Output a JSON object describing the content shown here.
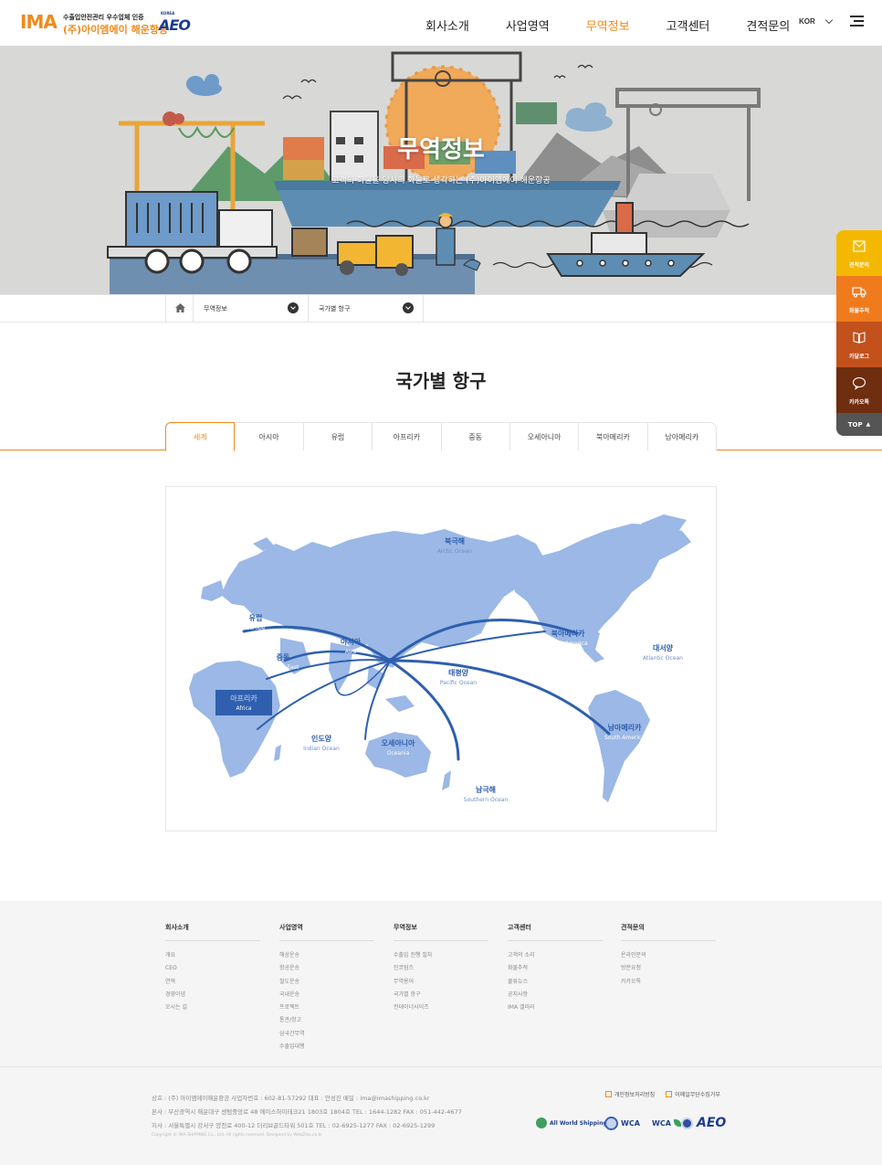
{
  "header": {
    "logo": {
      "brand": "IMA",
      "tagline": "수출입안전관리 우수업체 인증",
      "company": "(주)아이엠에이 해운항공",
      "korea": "KOREA",
      "aeo": "AEO"
    },
    "nav": [
      "회사소개",
      "사업영역",
      "무역정보",
      "고객센터",
      "견적문의"
    ],
    "active_nav": "무역정보",
    "lang": "KOR"
  },
  "hero": {
    "title": "무역정보",
    "subtitle": "고객의 화물을 당사의 화물로 생각하는 (주)아이엠에이 해운항공"
  },
  "breadcrumb": {
    "level1": "무역정보",
    "level2": "국가별 항구"
  },
  "page_title": "국가별 항구",
  "tabs": [
    "세계",
    "아시아",
    "유럽",
    "아프리카",
    "중동",
    "오세아니아",
    "북아메리카",
    "남아메리카"
  ],
  "active_tab": "세계",
  "map": {
    "oceans": [
      {
        "ko": "북극해",
        "en": "Arctic Ocean"
      },
      {
        "ko": "대서양",
        "en": "Atlantic Ocean"
      },
      {
        "ko": "태평양",
        "en": "Pacific Ocean"
      },
      {
        "ko": "인도양",
        "en": "Indian Ocean"
      },
      {
        "ko": "남극해",
        "en": "Southern Ocean"
      }
    ],
    "regions": [
      {
        "ko": "유럽",
        "en": "Europe"
      },
      {
        "ko": "아시아",
        "en": "Asia"
      },
      {
        "ko": "중동",
        "en": "Middle East"
      },
      {
        "ko": "아프리카",
        "en": "Africa"
      },
      {
        "ko": "오세아니아",
        "en": "Oceania"
      },
      {
        "ko": "북아메리카",
        "en": "North America"
      },
      {
        "ko": "남아메리카",
        "en": "South America"
      }
    ],
    "highlighted_region": "아프리카",
    "colors": {
      "land": "#9bb8e6",
      "route": "#2f5fae",
      "highlight": "#2f5fae"
    }
  },
  "quick_menu": [
    {
      "label": "견적문의",
      "icon": "quote-icon",
      "color": "#f5b800"
    },
    {
      "label": "화물추적",
      "icon": "truck-icon",
      "color": "#f07b1d"
    },
    {
      "label": "카달로그",
      "icon": "book-icon",
      "color": "#c2511c"
    },
    {
      "label": "카카오톡",
      "icon": "talk-icon",
      "color": "#6e2e0f"
    }
  ],
  "quick_top": "TOP",
  "footer": {
    "columns": [
      {
        "title": "회사소개",
        "items": [
          "개요",
          "CEO",
          "연혁",
          "경영이념",
          "오시는 길"
        ]
      },
      {
        "title": "사업영역",
        "items": [
          "해상운송",
          "항공운송",
          "철도운송",
          "국내운송",
          "프로젝트",
          "통관/창고",
          "삼국간무역",
          "수출입대행"
        ]
      },
      {
        "title": "무역정보",
        "items": [
          "수출입 진행 절차",
          "인코텀즈",
          "무역용어",
          "국가별 항구",
          "컨테이너사이즈"
        ]
      },
      {
        "title": "고객센터",
        "items": [
          "고객의 소리",
          "화물추적",
          "물류뉴스",
          "공지사항",
          "IMA 갤러리"
        ]
      },
      {
        "title": "견적문의",
        "items": [
          "온라인문의",
          "방문요청",
          "카카오톡"
        ]
      }
    ],
    "info": [
      "상호 : (주) 아이엠에이해운항공    사업자번호 : 602-81-57292    대표 : 안성진    메일 : ima@imashipping.co.kr",
      "본사 : 부산광역시 해운대구 센텀중앙로 48 에이스하이테크21 1803호 1804호    TEL : 1644-1282    FAX : 051-442-4677",
      "지사 : 서울특별시 강서구 양천로 400-12 더리브골드타워 501호    TEL : 02-6925-1277    FAX : 02-6925-1299"
    ],
    "copyright": "Copyright © IMA SHIPPING Co., Ltd. All rights reserved. Designed by WebZiko.co.kr",
    "links": [
      "개인정보처리방침",
      "이메일무단수집거부"
    ],
    "certs": [
      "All World Shipping",
      "WCA",
      "WCA",
      "AEO"
    ]
  }
}
